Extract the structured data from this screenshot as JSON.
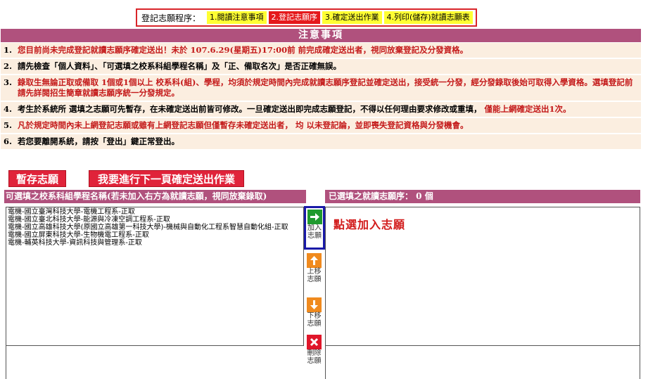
{
  "stepbar": {
    "label": "登記志願程序：",
    "steps": [
      "1.閱讀注意事項",
      "2.登記志願序",
      "3.確定送出作業",
      "4.列印(儲存)就讀志願表"
    ]
  },
  "notice": {
    "title": "注意事項",
    "items": [
      {
        "num": "1.",
        "text": "您目前尚未完成登記就讀志願序確定送出！未於 107.6.29(星期五)17:00前 前完成確定送出者，視同放棄登記及分發資格。"
      },
      {
        "num": "2.",
        "text": "請先檢查「個人資料」、「可選填之校系科組學程名稱」及「正、備取名次」是否正確無誤。"
      },
      {
        "num": "3.",
        "text": "錄取生無論正取或備取 1個或1個以上 校系科(組)、學程，均須於規定時間內完成就讀志願序登記並確定送出，接受統一分發，經分發錄取後始可取得入學資格。選填登記前請先詳閱招生簡章就讀志願序統一分發規定。"
      },
      {
        "num": "4.",
        "text_a": "考生於系統所 選填之志願可先暫存，在未確定送出前皆可修改。一旦確定送出即完成志願登記，不得以任何理由要求修改或重填，",
        "text_b": " 僅能上網確定送出1次。"
      },
      {
        "num": "5.",
        "text": "凡於規定時間內未上網登記志願或雖有上網登記志願但僅暫存未確定送出者， 均 以未登記論，並即喪失登記資格與分發機會。"
      },
      {
        "num": "6.",
        "text": "若您要離開系統，請按「登出」鍵正常登出。"
      }
    ]
  },
  "buttons": {
    "save": "暫存志願",
    "next": "我要進行下一頁確定送出作業"
  },
  "left_panel": {
    "title": "可選填之校系科組學程名稱(若未加入右方為就讀志願，視同放棄錄取)",
    "options": [
      "電機-國立臺灣科技大學-電機工程系-正取",
      "電機-國立臺北科技大學-能源與冷凍空調工程系-正取",
      "電機-國立高雄科技大學(原國立高雄第一科技大學)-機械與自動化工程系智慧自動化組-正取",
      "電機-國立屏東科技大學-生物機電工程系-正取",
      "電機-輔英科技大學-資訊科技與管理系-正取"
    ]
  },
  "right_panel": {
    "title": "已選填之就讀志願序： 0 個"
  },
  "actions": {
    "add": "加入志願",
    "up": "上移志願",
    "down": "下移志願",
    "delete": "刪除志願"
  },
  "hint": "點選加入志願",
  "colors": {
    "header_bg": "#b0517d",
    "note_bg": "#fbeee0",
    "button_red": "#e0233a",
    "active_step": "#e5191b",
    "inactive_step": "#ffff33"
  }
}
